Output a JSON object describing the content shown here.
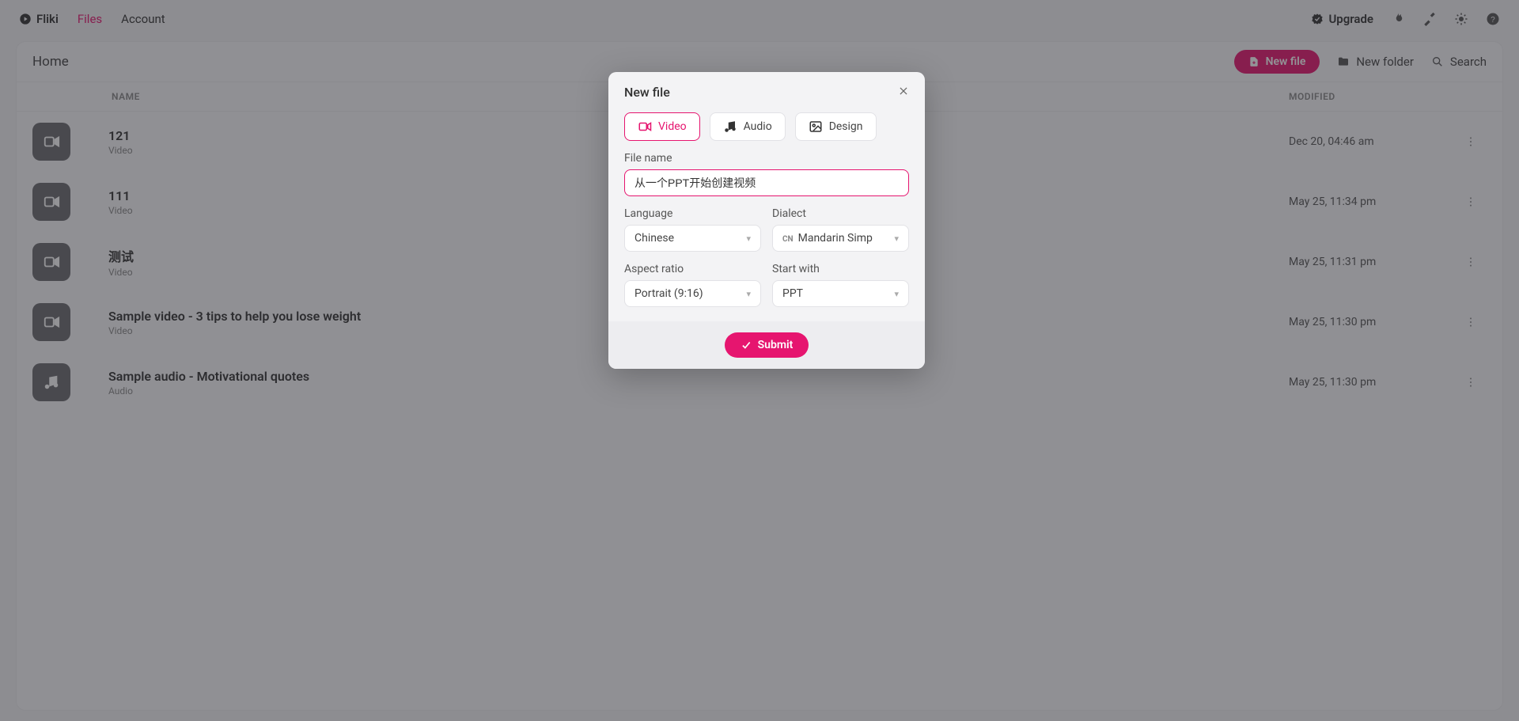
{
  "brand": "Fliki",
  "nav": {
    "files": "Files",
    "account": "Account",
    "upgrade": "Upgrade"
  },
  "toolbar": {
    "breadcrumb": "Home",
    "new_file": "New file",
    "new_folder": "New folder",
    "search": "Search"
  },
  "table": {
    "col_name": "NAME",
    "col_modified": "MODIFIED"
  },
  "files": [
    {
      "name": "121",
      "type": "Video",
      "modified": "Dec 20, 04:46 am",
      "icon": "video"
    },
    {
      "name": "111",
      "type": "Video",
      "modified": "May 25, 11:34 pm",
      "icon": "video"
    },
    {
      "name": "测试",
      "type": "Video",
      "modified": "May 25, 11:31 pm",
      "icon": "video"
    },
    {
      "name": "Sample video - 3 tips to help you lose weight",
      "type": "Video",
      "modified": "May 25, 11:30 pm",
      "icon": "video"
    },
    {
      "name": "Sample audio - Motivational quotes",
      "type": "Audio",
      "modified": "May 25, 11:30 pm",
      "icon": "audio"
    }
  ],
  "modal": {
    "title": "New file",
    "tabs": {
      "video": "Video",
      "audio": "Audio",
      "design": "Design"
    },
    "labels": {
      "file_name": "File name",
      "language": "Language",
      "dialect": "Dialect",
      "aspect_ratio": "Aspect ratio",
      "start_with": "Start with"
    },
    "file_name_value": "从一个PPT开始创建视频",
    "language_value": "Chinese",
    "dialect_flag": "CN",
    "dialect_value": "Mandarin Simp",
    "aspect_ratio_value": "Portrait (9:16)",
    "start_with_value": "PPT",
    "submit": "Submit"
  }
}
